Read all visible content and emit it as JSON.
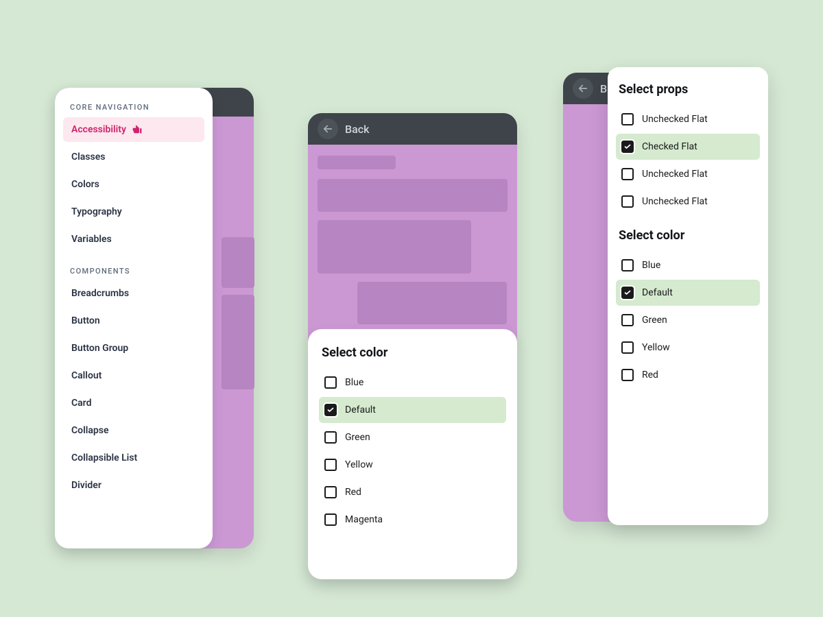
{
  "sidebar": {
    "sections": [
      {
        "title": "CORE NAVIGATION",
        "items": [
          {
            "label": "Accessibility",
            "active": true,
            "thumbs_down": true
          },
          {
            "label": "Classes"
          },
          {
            "label": "Colors"
          },
          {
            "label": "Typography"
          },
          {
            "label": "Variables"
          }
        ]
      },
      {
        "title": "COMPONENTS",
        "items": [
          {
            "label": "Breadcrumbs"
          },
          {
            "label": "Button"
          },
          {
            "label": "Button Group"
          },
          {
            "label": "Callout"
          },
          {
            "label": "Card"
          },
          {
            "label": "Collapse"
          },
          {
            "label": "Collapsible List"
          },
          {
            "label": "Divider"
          }
        ]
      }
    ]
  },
  "panel_b": {
    "back_label": "Back",
    "sheet": {
      "title": "Select color",
      "options": [
        {
          "label": "Blue",
          "checked": false
        },
        {
          "label": "Default",
          "checked": true
        },
        {
          "label": "Green",
          "checked": false
        },
        {
          "label": "Yellow",
          "checked": false
        },
        {
          "label": "Red",
          "checked": false
        },
        {
          "label": "Magenta",
          "checked": false
        }
      ]
    }
  },
  "panel_c": {
    "back_label": "B",
    "sheets": [
      {
        "title": "Select props",
        "options": [
          {
            "label": "Unchecked Flat",
            "checked": false
          },
          {
            "label": "Checked Flat",
            "checked": true
          },
          {
            "label": "Unchecked Flat",
            "checked": false
          },
          {
            "label": "Unchecked Flat",
            "checked": false
          }
        ]
      },
      {
        "title": "Select color",
        "options": [
          {
            "label": "Blue",
            "checked": false
          },
          {
            "label": "Default",
            "checked": true
          },
          {
            "label": "Green",
            "checked": false
          },
          {
            "label": "Yellow",
            "checked": false
          },
          {
            "label": "Red",
            "checked": false
          }
        ]
      }
    ]
  }
}
